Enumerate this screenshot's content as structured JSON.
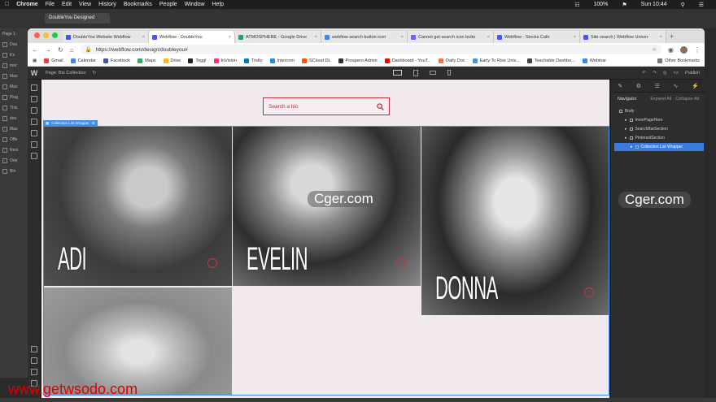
{
  "menubar": {
    "apple": "",
    "app": "Chrome",
    "items": [
      "File",
      "Edit",
      "View",
      "History",
      "Bookmarks",
      "People",
      "Window",
      "Help"
    ],
    "battery": "100%",
    "clock": "Sun 10:44"
  },
  "back_window": {
    "tab_title": "DoubleYou Designed",
    "page_label": "Page 1",
    "rows": [
      "Dou",
      "it's",
      "mor",
      "Mas",
      "Mas",
      "Plug",
      "This",
      "dou",
      "Mas",
      "Offe",
      "Resi",
      "One",
      "Blo"
    ]
  },
  "browser": {
    "tabs": [
      {
        "title": "DoubleYou Website Webflow",
        "fav": "#4353ff",
        "active": false
      },
      {
        "title": "Webflow - DoubleYou",
        "fav": "#4353ff",
        "active": true
      },
      {
        "title": "ATMOSPHERE - Google Drive",
        "fav": "#1fa463",
        "active": false
      },
      {
        "title": "webflow search button icon",
        "fav": "#4285f4",
        "active": false
      },
      {
        "title": "Cannot get search icon butto",
        "fav": "#7a5cff",
        "active": false
      },
      {
        "title": "Webflow - Stocks Cafe",
        "fav": "#4353ff",
        "active": false
      },
      {
        "title": "Site search | Webflow Univer",
        "fav": "#4353ff",
        "active": false
      }
    ],
    "new_tab": "+",
    "url": "https://webflow.com/design/doubleyou#",
    "bookmarks": [
      {
        "label": "Gmail",
        "color": "#ea4335"
      },
      {
        "label": "Calendar",
        "color": "#4285f4"
      },
      {
        "label": "Facebook",
        "color": "#3b5998"
      },
      {
        "label": "Maps",
        "color": "#34a853"
      },
      {
        "label": "Drive",
        "color": "#fbbc05"
      },
      {
        "label": "Toggl",
        "color": "#222222"
      },
      {
        "label": "InVision",
        "color": "#ff3366"
      },
      {
        "label": "Trello",
        "color": "#0079bf"
      },
      {
        "label": "Intercom",
        "color": "#1f8ded"
      },
      {
        "label": "SCloud DL",
        "color": "#ff5500"
      },
      {
        "label": "Prospero Admin",
        "color": "#333333"
      },
      {
        "label": "Dashboard - YouT...",
        "color": "#ff0000"
      },
      {
        "label": "Daily Doc",
        "color": "#ff7043"
      },
      {
        "label": "Early To Rise Univ...",
        "color": "#4a90e2"
      },
      {
        "label": "Teachable Dashbo...",
        "color": "#444444"
      },
      {
        "label": "Webinar",
        "color": "#2d8cff"
      },
      {
        "label": "Other Bookmarks",
        "color": "#777777"
      }
    ]
  },
  "webflow": {
    "logo": "W",
    "page_label": "Page: Bio Collection",
    "publish": "Publish",
    "search_placeholder": "Search a bio",
    "collection_badge": "Collection List Wrapper",
    "cards": [
      {
        "name": "ADI"
      },
      {
        "name": "EVELIN"
      },
      {
        "name": "DONNA"
      },
      {
        "name": ""
      }
    ],
    "navigator": {
      "title": "Navigator",
      "expand_all": "Expand All",
      "collapse_all": "Collapse All",
      "rows": [
        {
          "label": "Body",
          "selected": false,
          "indent": 0
        },
        {
          "label": "InnerPageHero",
          "selected": false,
          "indent": 1
        },
        {
          "label": "SearchBarSection",
          "selected": false,
          "indent": 1
        },
        {
          "label": "PinterestSection",
          "selected": false,
          "indent": 1
        },
        {
          "label": "Collection List Wrapper",
          "selected": true,
          "indent": 2
        }
      ]
    }
  },
  "watermarks": {
    "cger1": "Cger.com",
    "cger2": "Cger.com",
    "getwsodo": "www.getwsodo.com"
  },
  "colors": {
    "accent": "#b2313b",
    "selection": "#3b7be0",
    "canvas_bg": "#f1e9ee"
  }
}
